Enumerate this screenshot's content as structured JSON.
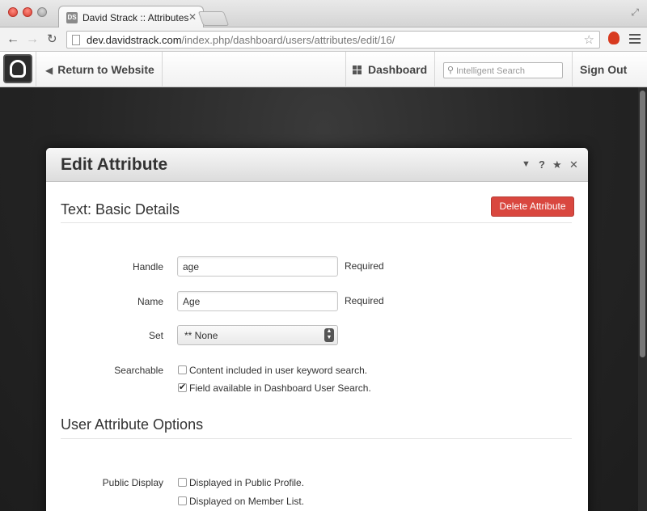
{
  "browser": {
    "tab_favicon": "DS",
    "tab_title": "David Strack :: Attributes",
    "url_host": "dev.davidstrack.com",
    "url_path": "/index.php/dashboard/users/attributes/edit/16/"
  },
  "c5_toolbar": {
    "return_label": "Return to Website",
    "dashboard_label": "Dashboard",
    "search_placeholder": "Intelligent Search",
    "signout_label": "Sign Out"
  },
  "dialog": {
    "title": "Edit Attribute",
    "section1_title": "Text: Basic Details",
    "delete_label": "Delete Attribute",
    "handle_label": "Handle",
    "handle_value": "age",
    "handle_help": "Required",
    "name_label": "Name",
    "name_value": "Age",
    "name_help": "Required",
    "set_label": "Set",
    "set_value": "** None",
    "searchable_label": "Searchable",
    "search_opt1": "Content included in user keyword search.",
    "search_opt1_checked": false,
    "search_opt2": "Field available in Dashboard User Search.",
    "search_opt2_checked": true,
    "section2_title": "User Attribute Options",
    "public_display_label": "Public Display",
    "public_opt1": "Displayed in Public Profile.",
    "public_opt1_checked": false,
    "public_opt2": "Displayed on Member List.",
    "public_opt2_checked": false
  }
}
